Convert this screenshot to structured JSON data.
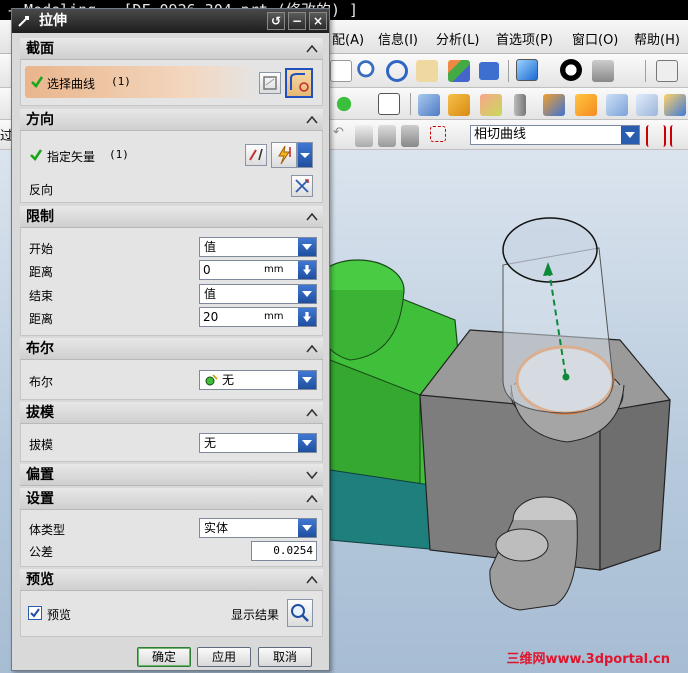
{
  "app": {
    "title_bar": "- Modeling - [DF-0926-304.prt  (修改的)  ]",
    "menu": [
      {
        "label": "配(A)"
      },
      {
        "label": "信息(I)"
      },
      {
        "label": "分析(L)"
      },
      {
        "label": "首选项(P)"
      },
      {
        "label": "窗口(O)"
      },
      {
        "label": "帮助(H)"
      }
    ],
    "left_edge_fragments": [
      "过",
      "ℓ"
    ],
    "selection_filter": {
      "value": "相切曲线"
    },
    "watermark": "三维网www.3dportal.cn",
    "colors": {
      "accent": "#2a5db0",
      "titlebar": "#1d1d1d",
      "model_green": "#3fbf3a",
      "model_gray": "#8c8c8c",
      "highlight": "#e07020"
    }
  },
  "dialog": {
    "title": "拉伸",
    "title_buttons": {
      "reset": "↺",
      "minimize": "−",
      "close": "×"
    },
    "sections": {
      "section": {
        "header": "截面",
        "select_curve_label": "选择曲线",
        "select_curve_count": "(1)"
      },
      "direction": {
        "header": "方向",
        "specify_vector_label": "指定矢量",
        "specify_vector_count": "(1)",
        "reverse_label": "反向"
      },
      "limits": {
        "header": "限制",
        "start_label": "开始",
        "start_value": "值",
        "start_distance_label": "距离",
        "start_distance_value": "0",
        "start_distance_unit": "mm",
        "end_label": "结束",
        "end_value": "值",
        "end_distance_label": "距离",
        "end_distance_value": "20",
        "end_distance_unit": "mm"
      },
      "boolean": {
        "header": "布尔",
        "label": "布尔",
        "value": "无"
      },
      "draft": {
        "header": "拔模",
        "label": "拔模",
        "value": "无"
      },
      "offset": {
        "header": "偏置"
      },
      "settings": {
        "header": "设置",
        "body_type_label": "体类型",
        "body_type_value": "实体",
        "tolerance_label": "公差",
        "tolerance_value": "0.0254"
      },
      "preview": {
        "header": "预览",
        "preview_checkbox_label": "预览",
        "preview_checked": true,
        "show_result_label": "显示结果"
      }
    },
    "buttons": {
      "ok": "确定",
      "apply": "应用",
      "cancel": "取消"
    }
  }
}
